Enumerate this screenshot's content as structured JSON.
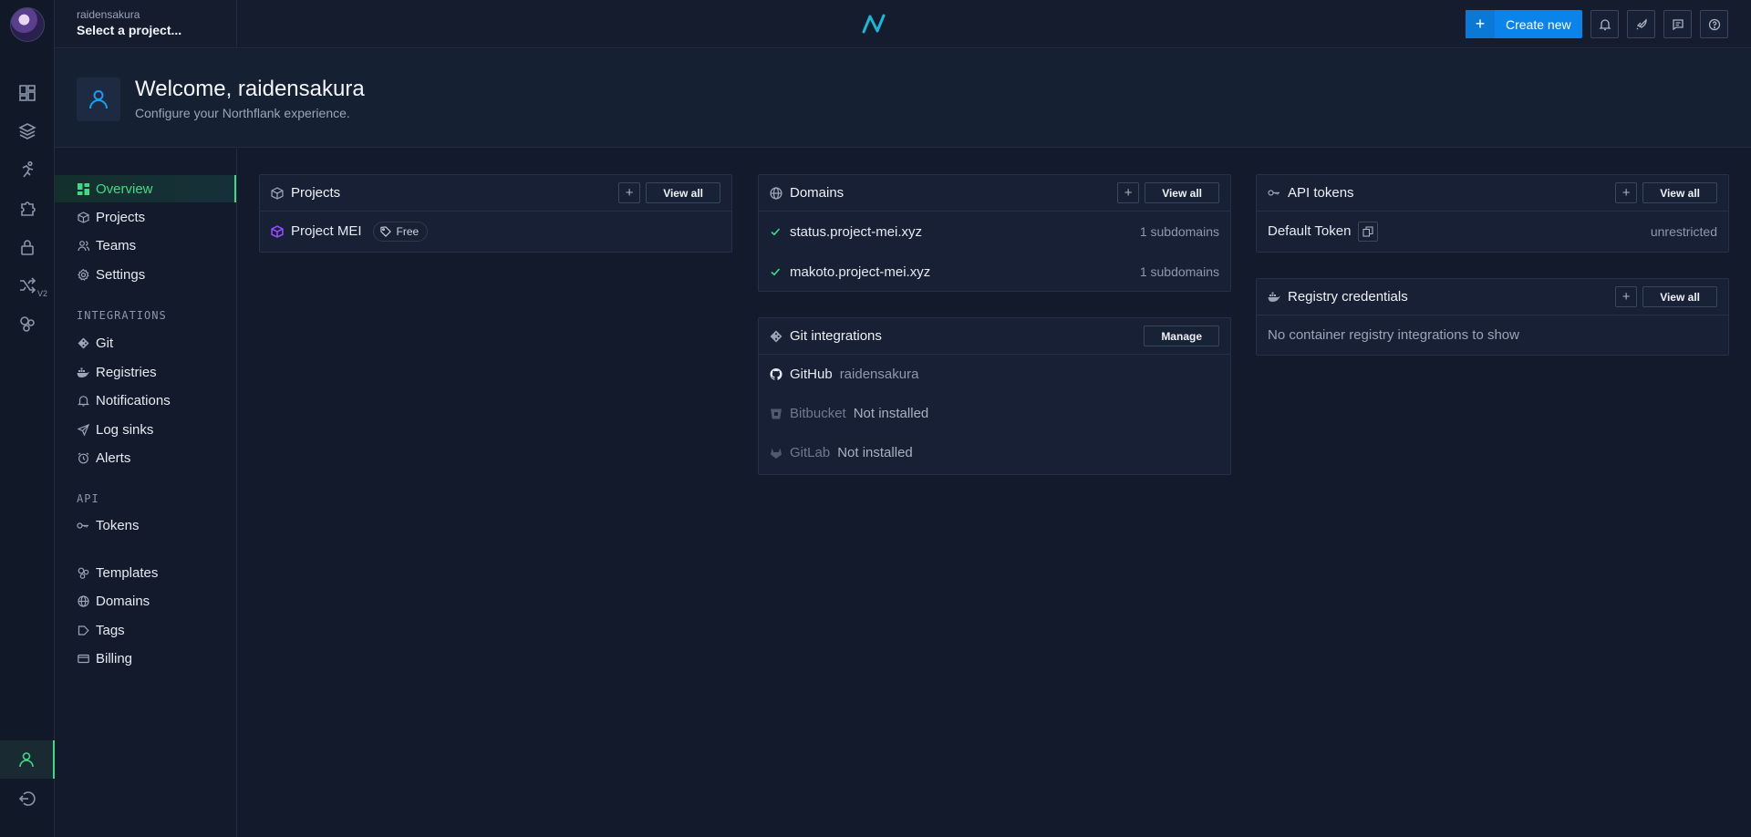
{
  "header": {
    "username": "raidensakura",
    "project_selector": "Select a project...",
    "create_new": "Create new"
  },
  "welcome": {
    "title": "Welcome, raidensakura",
    "subtitle": "Configure your Northflank experience."
  },
  "menu": {
    "overview": "Overview",
    "projects": "Projects",
    "teams": "Teams",
    "settings": "Settings",
    "integrations_heading": "INTEGRATIONS",
    "git": "Git",
    "registries": "Registries",
    "notifications": "Notifications",
    "log_sinks": "Log sinks",
    "alerts": "Alerts",
    "api_heading": "API",
    "tokens": "Tokens",
    "templates": "Templates",
    "domains": "Domains",
    "tags": "Tags",
    "billing": "Billing"
  },
  "projects_card": {
    "title": "Projects",
    "view_all": "View all",
    "items": [
      {
        "name": "Project MEI",
        "tag": "Free"
      }
    ]
  },
  "domains_card": {
    "title": "Domains",
    "view_all": "View all",
    "items": [
      {
        "name": "status.project-mei.xyz",
        "subdomains": "1 subdomains"
      },
      {
        "name": "makoto.project-mei.xyz",
        "subdomains": "1 subdomains"
      }
    ]
  },
  "git_card": {
    "title": "Git integrations",
    "manage": "Manage",
    "items": [
      {
        "provider": "GitHub",
        "status": "raidensakura"
      },
      {
        "provider": "Bitbucket",
        "status": "Not installed"
      },
      {
        "provider": "GitLab",
        "status": "Not installed"
      }
    ]
  },
  "tokens_card": {
    "title": "API tokens",
    "view_all": "View all",
    "items": [
      {
        "name": "Default Token",
        "scope": "unrestricted"
      }
    ]
  },
  "registry_card": {
    "title": "Registry credentials",
    "view_all": "View all",
    "empty": "No container registry integrations to show"
  },
  "colors": {
    "accent_green": "#3ddc84",
    "primary_blue": "#0a84ea",
    "background": "#121a2b",
    "card": "#172034"
  }
}
